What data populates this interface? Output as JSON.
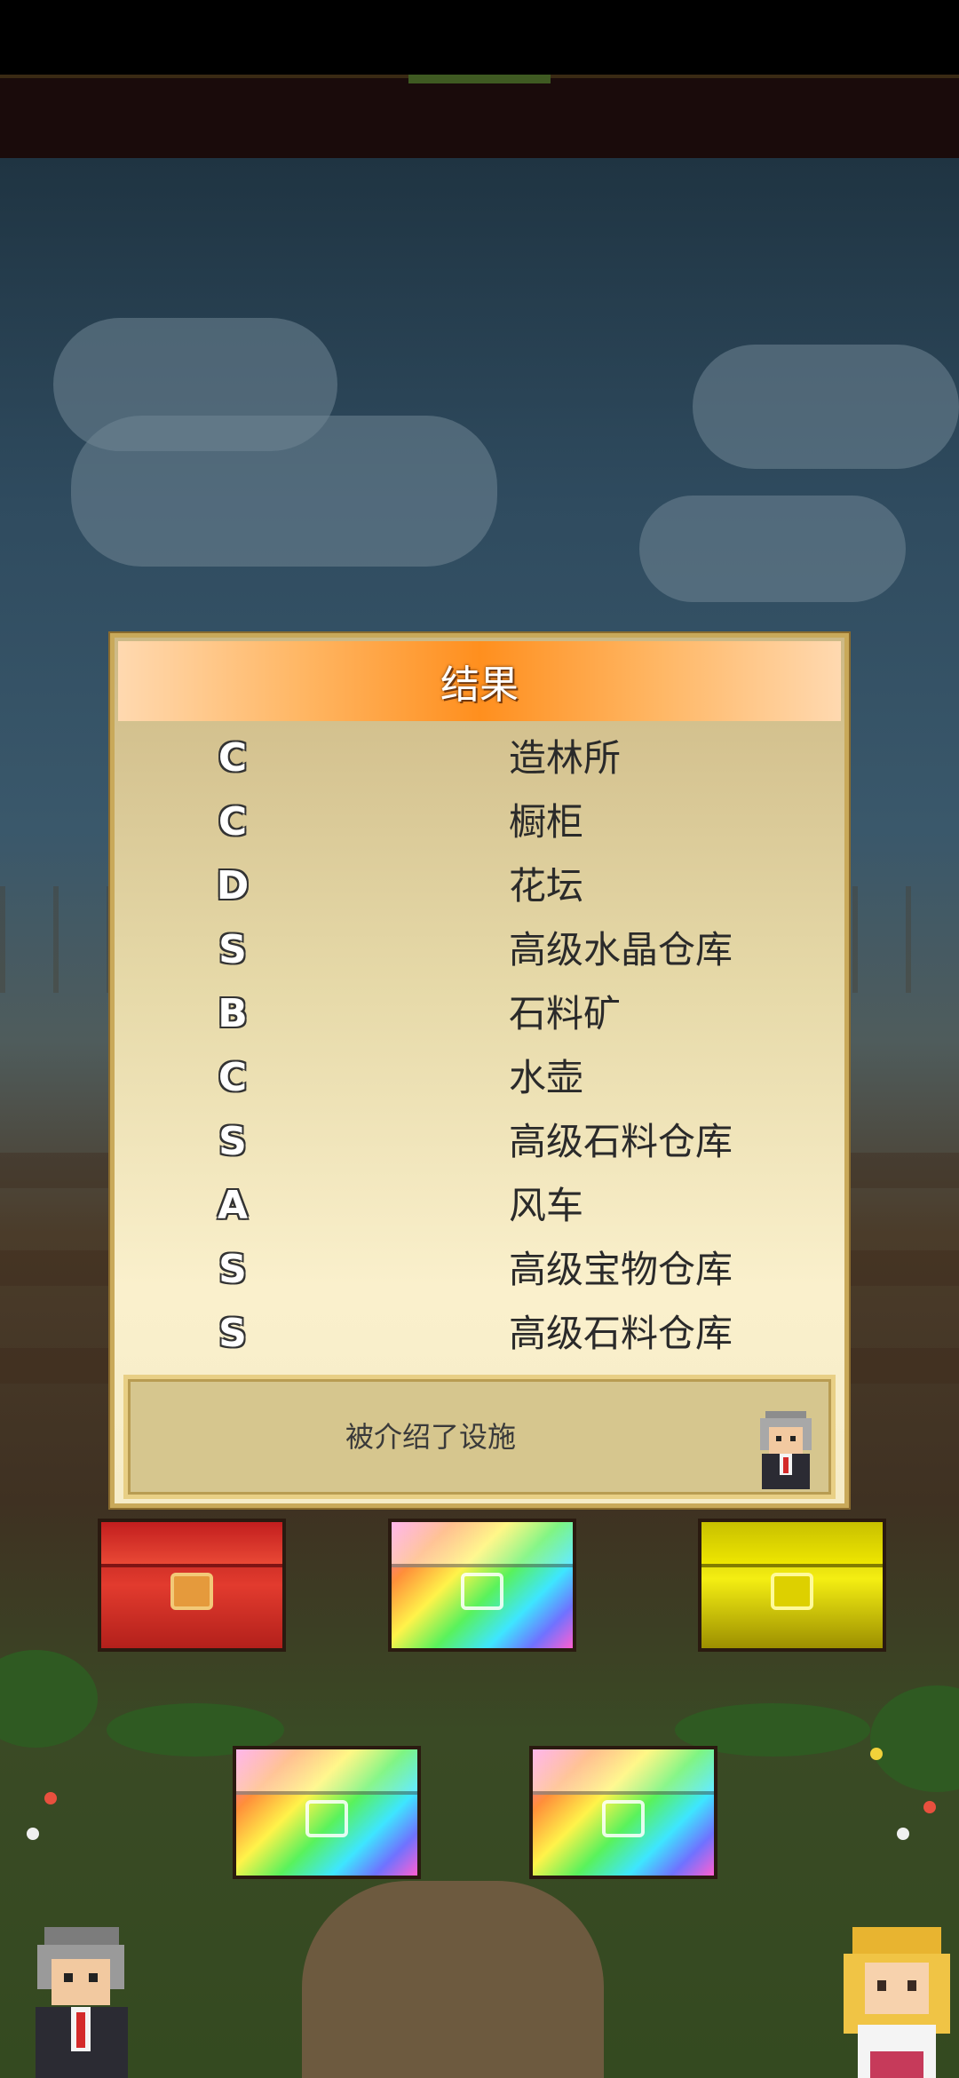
{
  "dialog": {
    "title": "结果",
    "results": [
      {
        "rank": "C",
        "facility": "造林所"
      },
      {
        "rank": "C",
        "facility": "橱柜"
      },
      {
        "rank": "D",
        "facility": "花坛"
      },
      {
        "rank": "S",
        "facility": "高级水晶仓库"
      },
      {
        "rank": "B",
        "facility": "石料矿"
      },
      {
        "rank": "C",
        "facility": "水壶"
      },
      {
        "rank": "S",
        "facility": "高级石料仓库"
      },
      {
        "rank": "A",
        "facility": "风车"
      },
      {
        "rank": "S",
        "facility": "高级宝物仓库"
      },
      {
        "rank": "S",
        "facility": "高级石料仓库"
      }
    ],
    "message": "被介绍了设施"
  },
  "chests": [
    {
      "type": "red",
      "icon": "treasure-chest-red-icon"
    },
    {
      "type": "rainbow",
      "icon": "treasure-chest-rainbow-icon"
    },
    {
      "type": "gold",
      "icon": "treasure-chest-gold-icon"
    },
    {
      "type": "rainbow",
      "icon": "treasure-chest-rainbow-icon"
    },
    {
      "type": "rainbow",
      "icon": "treasure-chest-rainbow-icon"
    }
  ],
  "colors": {
    "header_accent": "#ff8f1e",
    "dialog_border": "#c9a95a",
    "message_box": "#d6c68e"
  }
}
